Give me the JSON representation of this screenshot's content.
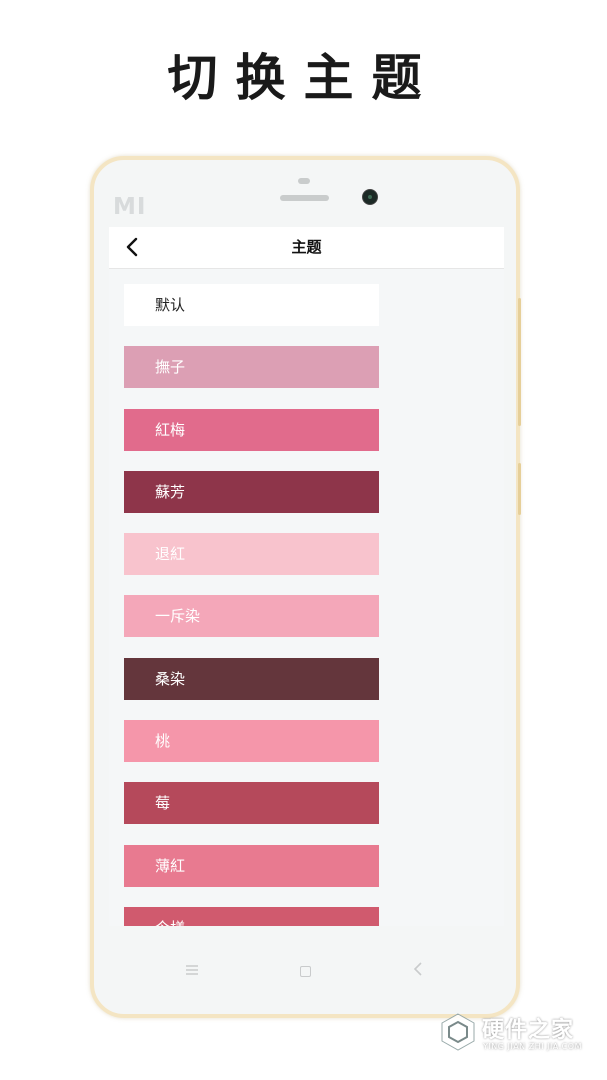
{
  "promo": {
    "title": "切换主题"
  },
  "device": {
    "brand_logo": "MI"
  },
  "header": {
    "back_icon": "chevron-left-icon",
    "title": "主题"
  },
  "themes": [
    {
      "label": "默认",
      "color": "#ffffff"
    },
    {
      "label": "撫子",
      "color": "#dc9fb4"
    },
    {
      "label": "紅梅",
      "color": "#e16b8c"
    },
    {
      "label": "蘇芳",
      "color": "#8e354a"
    },
    {
      "label": "退紅",
      "color": "#f8c3cd"
    },
    {
      "label": "一斥染",
      "color": "#f4a7b9"
    },
    {
      "label": "桑染",
      "color": "#64363c"
    },
    {
      "label": "桃",
      "color": "#f596aa"
    },
    {
      "label": "莓",
      "color": "#b5495b"
    },
    {
      "label": "薄紅",
      "color": "#e87a90"
    },
    {
      "label": "今様",
      "color": "#d05a6e"
    }
  ],
  "navigation": {
    "menu_icon": "menu-icon",
    "home_icon": "home-square-icon",
    "back_icon": "back-triangle-icon"
  },
  "watermark": {
    "text": "硬件之家",
    "sub": "YING JIAN ZHI JIA.COM"
  }
}
